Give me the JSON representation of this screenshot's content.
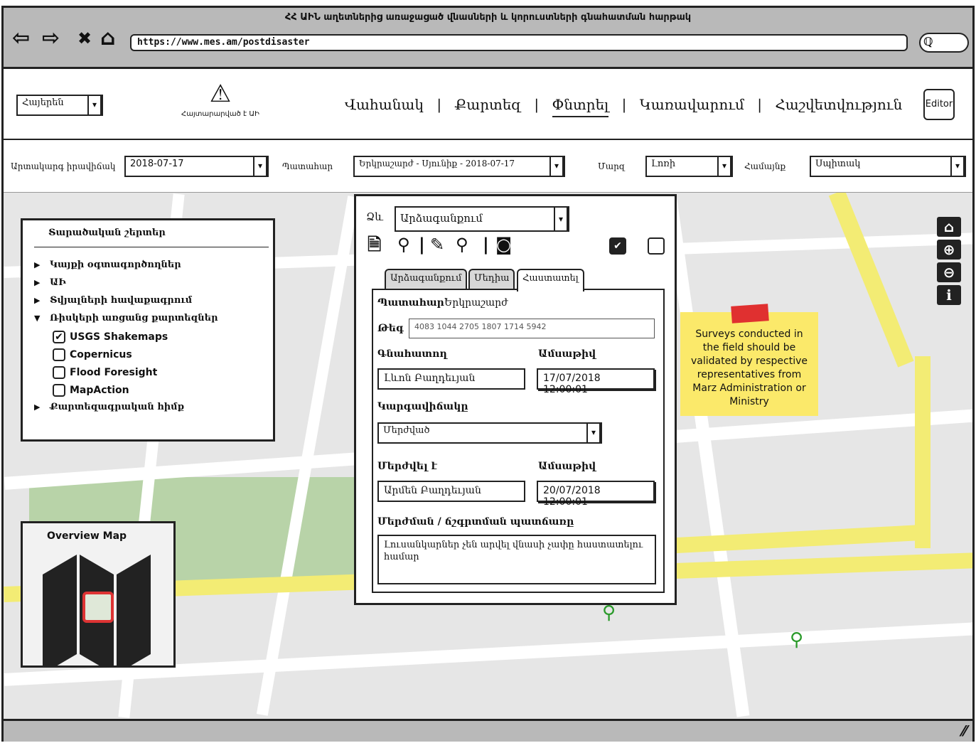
{
  "window": {
    "title": "ՀՀ ԱԻՆ աղետներից առաջացած վնասների և կորուստների գնահատման հարթակ",
    "url": "https://www.mes.am/postdisaster"
  },
  "browser": {
    "back": "⇦",
    "forward": "⇨",
    "stop": "✖",
    "home": "⌂",
    "search_glyph": "ℚ"
  },
  "header": {
    "language": "Հայերեն",
    "warning_text": "Հայտարարված է ԱԻ",
    "nav": [
      "Վահանակ",
      "Քարտեզ",
      "Փնտրել",
      "Կառավարում",
      "Հաշվետվություն"
    ],
    "nav_sep": "|",
    "editor": "Editor"
  },
  "filters": {
    "date_label": "Արտակարգ իրավիճակ",
    "date_value": "2018-07-17",
    "event_label": "Պատահար",
    "event_value": "Երկրաշարժ - Սյունիք - 2018-07-17",
    "region_label": "Մարզ",
    "region_value": "Լոռի",
    "community_label": "Համայնք",
    "community_value": "Սպիտակ"
  },
  "legend": {
    "title": "Տարածական շերտեր",
    "items": [
      "Կայքի օգտագործողներ",
      "ԱԻ",
      "Տվյալների հավաքագրում",
      "Ռիսկերի առցանց քարտեզներ"
    ],
    "sub_items": [
      {
        "label": "USGS Shakemaps",
        "checked": true
      },
      {
        "label": "Copernicus",
        "checked": false
      },
      {
        "label": "Flood Foresight",
        "checked": false
      },
      {
        "label": "MapAction",
        "checked": false
      }
    ],
    "last_item": "Քարտեզագրական հիմք"
  },
  "overview": {
    "title": "Overview Map"
  },
  "map_tools": [
    "home-icon",
    "zoom-in-icon",
    "zoom-out-icon",
    "info-icon"
  ],
  "sticky_note": "Surveys conducted in the field should be validated by respective representatives from Marz Administration or Ministry",
  "popup": {
    "form_label": "Ձև",
    "form_value": "Արձագանքում",
    "tabs": [
      "Արձագանքում",
      "Մեդիա",
      "Հաստատել"
    ],
    "active_tab": 2,
    "event_label": "Պատահար`",
    "event_value": "Երկրաշարժ",
    "tag_label": "Թեգ",
    "tag_value": "4083 1044 2705 1807 1714 5942",
    "evaluator_label": "Գնահատող",
    "evaluator_value": "Լևոն Բաղդեւյան",
    "date1_label": "Ամսաթիվ",
    "date1_value": "17/07/2018  12:00:01",
    "status_label": "Կարգավիճակը",
    "status_value": "Մերժված",
    "rejected_by_label": "Մերժվել է",
    "rejected_by_value": "Արմեն Բաղդեւյան",
    "date2_label": "Ամսաթիվ",
    "date2_value": "20/07/2018  12:00:01",
    "reason_label": "Մերժման / ճշգրտման պատճառը",
    "reason_value": "Լուսանկարներ չեն արվել վնասի չափը հաստատելու համար"
  },
  "colors": {
    "road": "#f3ec74",
    "park": "#b8d3a8",
    "pin": "#2a9a2a",
    "note": "#fbe96a"
  }
}
